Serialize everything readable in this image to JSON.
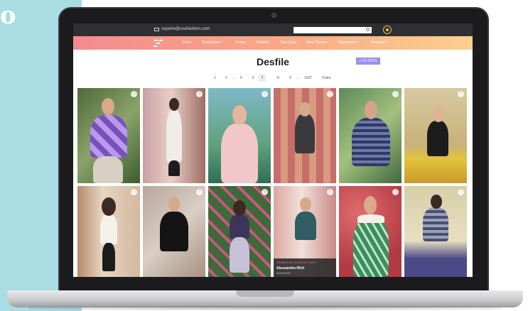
{
  "background": {
    "letter": "o"
  },
  "topbar": {
    "email": "suporte@usefashion.com",
    "search_placeholder": ""
  },
  "nav": {
    "items": [
      "Início",
      "Tendências",
      "Feiras",
      "Desfiles",
      "Nas Lojas",
      "Area Técnica",
      "Segmentos",
      "Imagens"
    ]
  },
  "page": {
    "title": "Desfile",
    "filter_label": "FILTROS"
  },
  "pagination": {
    "items": [
      "1",
      "2",
      "...",
      "5",
      "6",
      "7",
      "8",
      "9",
      "...",
      "1037",
      "Outre"
    ],
    "active": "7"
  },
  "caption": {
    "tag": "SEMANA DE MODA DE PARIS",
    "name": "Alessandra Rich",
    "date": "02/04/2021"
  }
}
